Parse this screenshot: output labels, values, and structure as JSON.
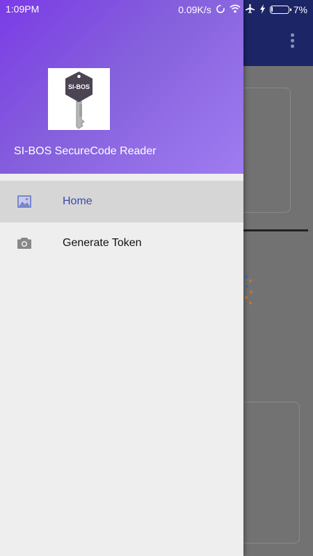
{
  "status_bar": {
    "time": "1:09PM",
    "network_speed": "0.09K/s",
    "battery_percent": "7%",
    "battery_level": 0.07
  },
  "drawer": {
    "app_name": "SI-BOS SecureCode Reader",
    "logo_text": "SI-BOS",
    "header_colors": [
      "#7b3be6",
      "#a07cf2"
    ],
    "menu": [
      {
        "label": "Home",
        "icon": "image-icon",
        "active": true
      },
      {
        "label": "Generate Token",
        "icon": "camera-icon",
        "active": false
      }
    ],
    "active_color": "#3949ab"
  }
}
